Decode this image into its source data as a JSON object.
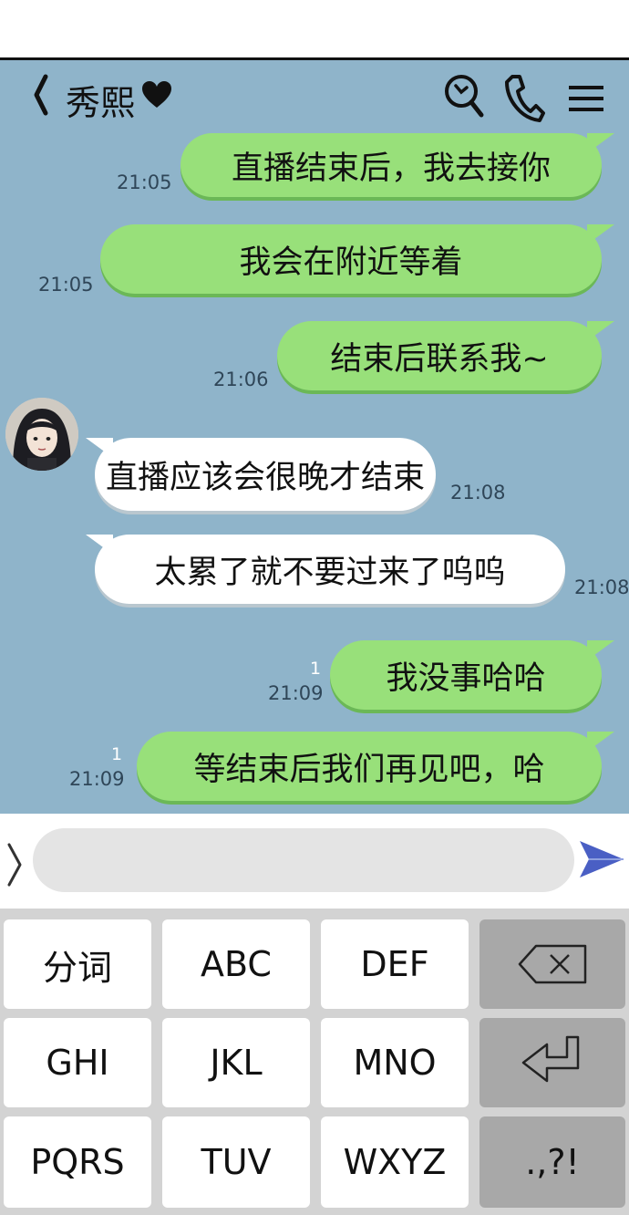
{
  "header": {
    "contact_name": "秀熙",
    "icons": [
      "back-chevron-icon",
      "heart-icon",
      "search-icon",
      "phone-call-icon",
      "menu-icon"
    ]
  },
  "messages": [
    {
      "text": "直播结束后，我去接你",
      "time": "21:05",
      "side": "right"
    },
    {
      "text": "我会在附近等着",
      "time": "21:05",
      "side": "right"
    },
    {
      "text": "结束后联系我~",
      "time": "21:06",
      "side": "right"
    },
    {
      "text": "直播应该会很晚才结束",
      "time": "21:08",
      "side": "left"
    },
    {
      "text": "太累了就不要过来了呜呜",
      "time": "21:08",
      "side": "left"
    },
    {
      "text": "我没事哈哈",
      "time": "21:09",
      "side": "right",
      "read": "1"
    },
    {
      "text": "等结束后我们再见吧，哈",
      "time": "21:09",
      "side": "right",
      "read": "1"
    }
  ],
  "input": {
    "placeholder": "",
    "value": ""
  },
  "keyboard": {
    "rows": [
      [
        "分词",
        "ABC",
        "DEF",
        "backspace"
      ],
      [
        "GHI",
        "JKL",
        "MNO",
        "enter"
      ],
      [
        "PQRS",
        "TUV",
        "WXYZ",
        ".,?!"
      ]
    ]
  },
  "colors": {
    "chat_bg": "#8fb4ca",
    "bubble_sent": "#98e07a",
    "bubble_received": "#ffffff",
    "send_icon": "#4a5fc4",
    "keyboard_bg": "#d3d3d3",
    "key_gray": "#a8a8a8"
  }
}
